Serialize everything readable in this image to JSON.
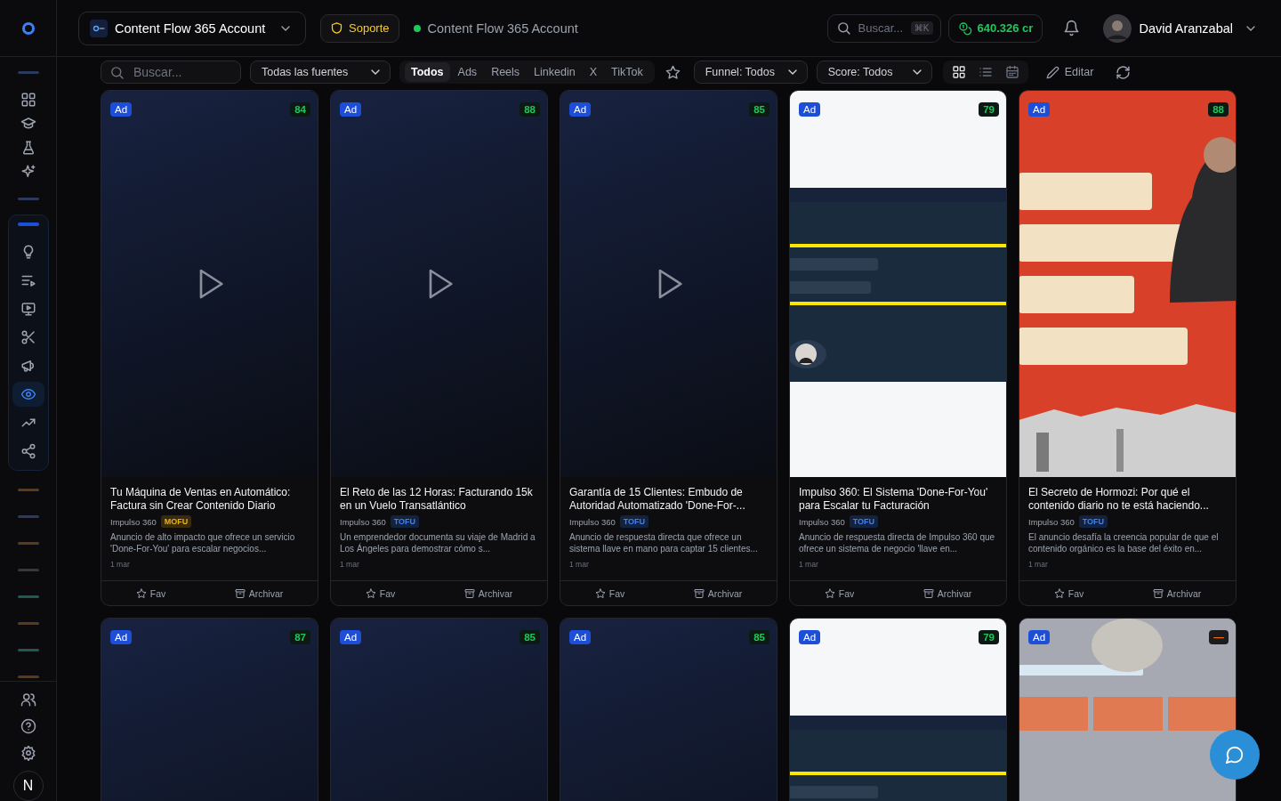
{
  "sidebar": {
    "top_items": [
      {
        "kind": "grid",
        "selected": false
      },
      {
        "kind": "cap",
        "selected": false
      },
      {
        "kind": "flask",
        "selected": false
      },
      {
        "kind": "sparkles",
        "selected": false
      }
    ],
    "group_items": [
      {
        "kind": "bulb",
        "selected": false
      },
      {
        "kind": "listplay",
        "selected": false
      },
      {
        "kind": "monitor",
        "selected": false
      },
      {
        "kind": "scissors",
        "selected": false
      },
      {
        "kind": "megaphone",
        "selected": false
      },
      {
        "kind": "eye",
        "selected": true
      },
      {
        "kind": "trend",
        "selected": false
      },
      {
        "kind": "share",
        "selected": false
      }
    ],
    "section_marks": [
      {
        "color": "#5b3a1c"
      },
      {
        "color": "#2a3a62"
      },
      {
        "color": "#5b3a1c"
      },
      {
        "color": "#34373e"
      },
      {
        "color": "#1d5a52"
      },
      {
        "color": "#5b3a1c"
      },
      {
        "color": "#1d5a52"
      },
      {
        "color": "#5b3a1c"
      }
    ],
    "bottom_items": [
      {
        "kind": "users",
        "selected": false
      },
      {
        "kind": "help",
        "selected": false
      },
      {
        "kind": "gear",
        "selected": false
      }
    ],
    "user_initial": "N"
  },
  "header": {
    "account": "Content Flow 365 Account",
    "support": "Soporte",
    "workspace": "Content Flow 365 Account",
    "search_placeholder": "Buscar...",
    "shortcut": "⌘K",
    "credits": "640.326 cr",
    "user": "David Aranzabal"
  },
  "filters": {
    "search_placeholder": "Buscar...",
    "source": "Todas las fuentes",
    "tabs": [
      {
        "label": "Todos",
        "selected": true
      },
      {
        "label": "Ads",
        "selected": false
      },
      {
        "label": "Reels",
        "selected": false
      },
      {
        "label": "Linkedin",
        "selected": false
      },
      {
        "label": "X",
        "selected": false
      },
      {
        "label": "TikTok",
        "selected": false
      }
    ],
    "funnel": "Funnel: Todos",
    "score": "Score: Todos",
    "views": [
      {
        "kind": "grid",
        "selected": true
      },
      {
        "kind": "list",
        "selected": false
      },
      {
        "kind": "calendar",
        "selected": false
      }
    ],
    "edit": "Editar"
  },
  "cards": [
    {
      "badge": "Ad",
      "score": {
        "value": "84",
        "kind": "rated"
      },
      "thumbnail": {
        "kind": "video"
      },
      "title": "Tu Máquina de Ventas en Automático: Factura sin Crear Contenido Diario",
      "source": "Impulso 360",
      "funnel": {
        "label": "MOFU",
        "kind": "middle"
      },
      "description": "Anuncio de alto impacto que ofrece un servicio 'Done-For-You' para escalar negocios...",
      "date": "1 mar",
      "fav": "Fav",
      "archive": "Archivar"
    },
    {
      "badge": "Ad",
      "score": {
        "value": "88",
        "kind": "rated"
      },
      "thumbnail": {
        "kind": "video"
      },
      "title": "El Reto de las 12 Horas: Facturando 15k en un Vuelo Transatlántico",
      "source": "Impulso 360",
      "funnel": {
        "label": "TOFU",
        "kind": "top"
      },
      "description": "Un emprendedor documenta su viaje de Madrid a Los Ángeles para demostrar cómo s...",
      "date": "1 mar",
      "fav": "Fav",
      "archive": "Archivar"
    },
    {
      "badge": "Ad",
      "score": {
        "value": "85",
        "kind": "rated"
      },
      "thumbnail": {
        "kind": "video"
      },
      "title": "Garantía de 15 Clientes: Embudo de Autoridad Automatizado 'Done-For-...",
      "source": "Impulso 360",
      "funnel": {
        "label": "TOFU",
        "kind": "top"
      },
      "description": "Anuncio de respuesta directa que ofrece un sistema llave en mano para captar 15 clientes...",
      "date": "1 mar",
      "fav": "Fav",
      "archive": "Archivar"
    },
    {
      "badge": "Ad",
      "score": {
        "value": "79",
        "kind": "rated"
      },
      "title": "Impulso 360: El Sistema 'Done-For-You' para Escalar tu Facturación",
      "source": "Impulso 360",
      "funnel": {
        "label": "TOFU",
        "kind": "top"
      },
      "description": "Anuncio de respuesta directa de Impulso 360 que ofrece un sistema de negocio 'llave en...",
      "date": "1 mar",
      "fav": "Fav",
      "archive": "Archivar"
    },
    {
      "badge": "Ad",
      "score": {
        "value": "88",
        "kind": "rated"
      },
      "title": "El Secreto de Hormozi: Por qué el contenido diario no te está haciendo...",
      "source": "Impulso 360",
      "funnel": {
        "label": "TOFU",
        "kind": "top"
      },
      "description": "El anuncio desafía la creencia popular de que el contenido orgánico es la base del éxito en...",
      "date": "1 mar",
      "fav": "Fav",
      "archive": "Archivar"
    },
    {
      "badge": "Ad",
      "score": {
        "value": "87",
        "kind": "rated"
      },
      "thumbnail": {
        "kind": "video"
      }
    },
    {
      "badge": "Ad",
      "score": {
        "value": "85",
        "kind": "rated"
      },
      "thumbnail": {
        "kind": "video"
      }
    },
    {
      "badge": "Ad",
      "score": {
        "value": "85",
        "kind": "rated"
      },
      "thumbnail": {
        "kind": "video"
      }
    },
    {
      "badge": "Ad",
      "score": {
        "value": "79",
        "kind": "rated"
      }
    },
    {
      "badge": "Ad",
      "score": {
        "value": "—",
        "kind": "unrated"
      }
    }
  ]
}
